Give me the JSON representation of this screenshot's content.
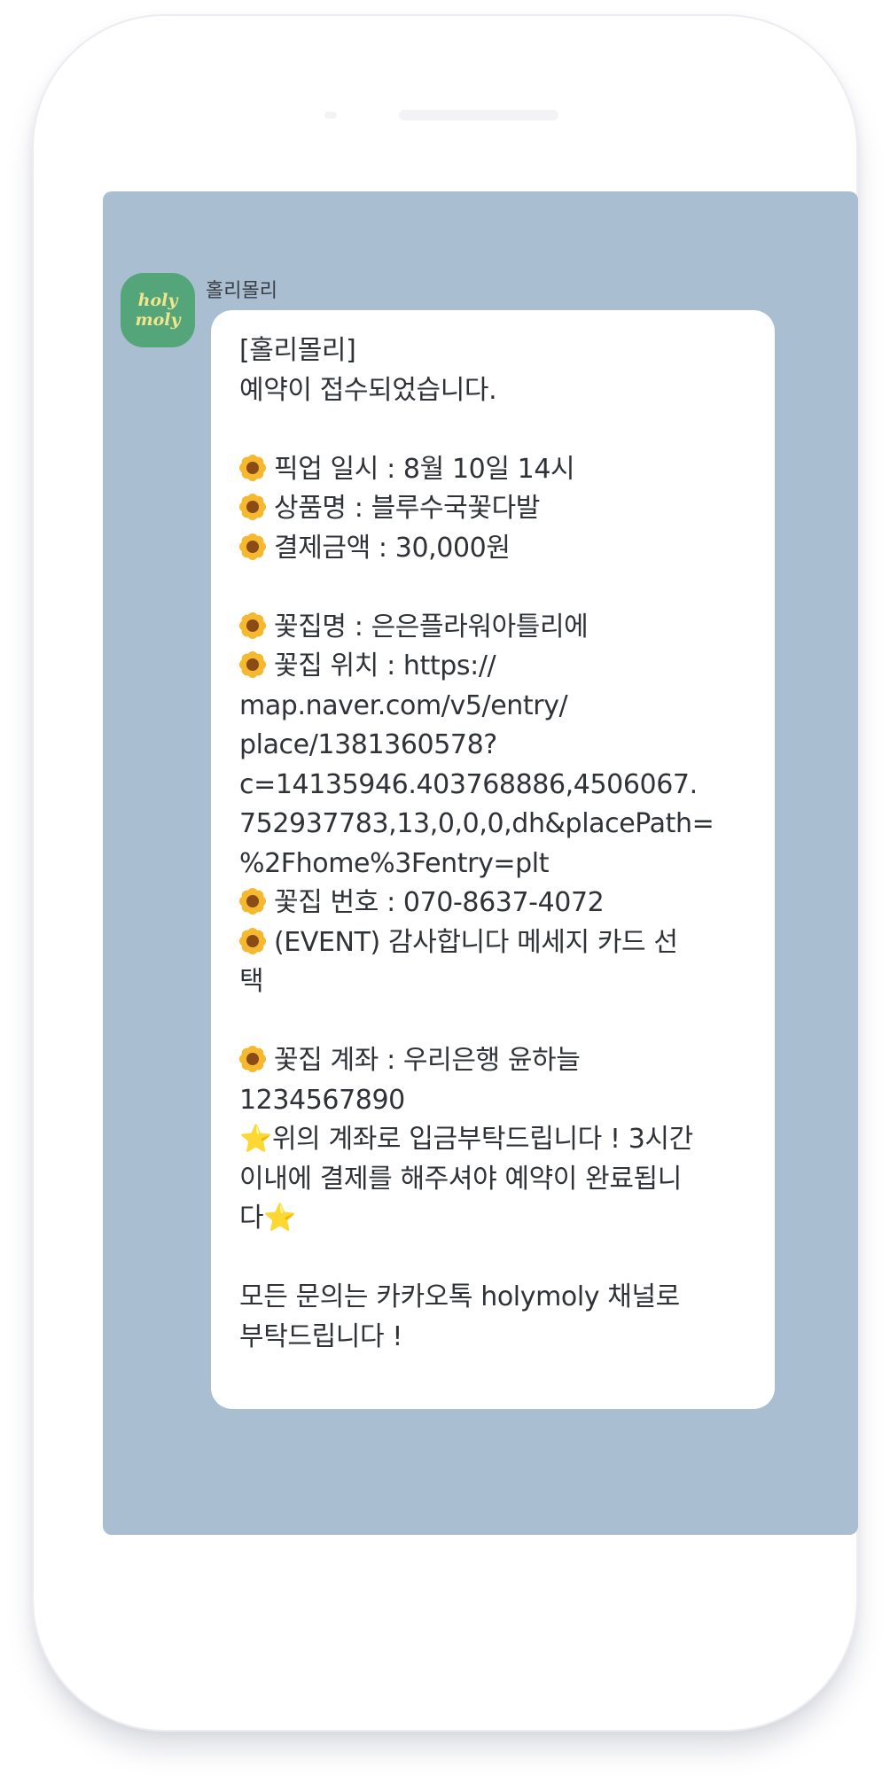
{
  "chat": {
    "avatar": {
      "line1": "holy",
      "line2": "moly"
    },
    "sender_name": "홀리몰리",
    "message": {
      "title": "[홀리몰리]",
      "intro": "예약이 접수되었습니다.",
      "pickup": "픽업 일시 : 8월 10일 14시",
      "product": "상품명 : 블루수국꽃다발",
      "amount": "결제금액 : 30,000원",
      "shop_name": "꽃집명 : 은은플라워아틀리에",
      "location_label": "꽃집 위치 : https://",
      "location_url_2": "map.naver.com/v5/entry/",
      "location_url_3": "place/1381360578?",
      "location_url_4": "c=14135946.403768886,4506067.",
      "location_url_5": "752937783,13,0,0,0,dh&placePath=",
      "location_url_6": "%2Fhome%3Fentry=plt",
      "phone": "꽃집 번호 : 070-8637-4072",
      "event_1": "(EVENT) 감사합니다 메세지 카드 선",
      "event_2": "택",
      "account_1": "꽃집 계좌 : 우리은행 윤하늘",
      "account_2": "1234567890",
      "notice_1": "위의 계좌로 입금부탁드립니다 ! 3시간",
      "notice_2": "이내에 결제를 해주셔야 예약이 완료됩니",
      "notice_3": "다",
      "inquiry_1": "모든 문의는 카카오톡 holymoly 채널로",
      "inquiry_2": "부탁드립니다 !"
    },
    "icons": {
      "bullet": "sunflower-emoji-icon",
      "emphasis": "star-emoji-icon"
    },
    "colors": {
      "chat_background": "#a9bed0",
      "avatar_background": "#54a57a",
      "avatar_text": "#f3e58a",
      "bubble_background": "#ffffff"
    }
  }
}
